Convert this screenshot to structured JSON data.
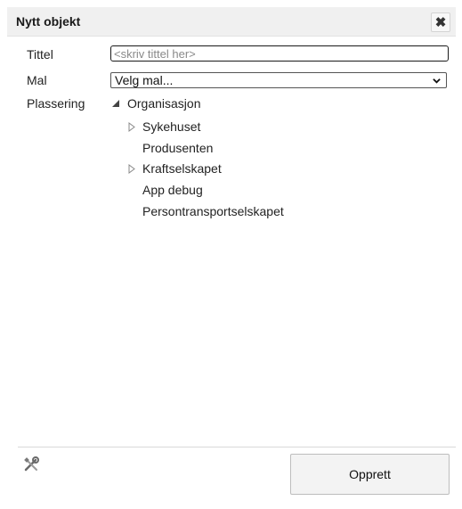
{
  "dialog": {
    "title": "Nytt objekt",
    "close_icon": "close-x-icon"
  },
  "form": {
    "title_label": "Tittel",
    "title_placeholder": "<skriv tittel her>",
    "title_value": "",
    "template_label": "Mal",
    "template_selected": "Velg mal...",
    "location_label": "Plassering"
  },
  "tree": {
    "root": {
      "label": "Organisasjon",
      "expanded": true
    },
    "children": [
      {
        "label": "Sykehuset",
        "has_children": true
      },
      {
        "label": "Produsenten",
        "has_children": false
      },
      {
        "label": "Kraftselskapet",
        "has_children": true
      },
      {
        "label": "App debug",
        "has_children": false
      },
      {
        "label": "Persontransportselskapet",
        "has_children": false
      }
    ]
  },
  "footer": {
    "tools_icon": "tools-icon",
    "create_label": "Opprett"
  }
}
